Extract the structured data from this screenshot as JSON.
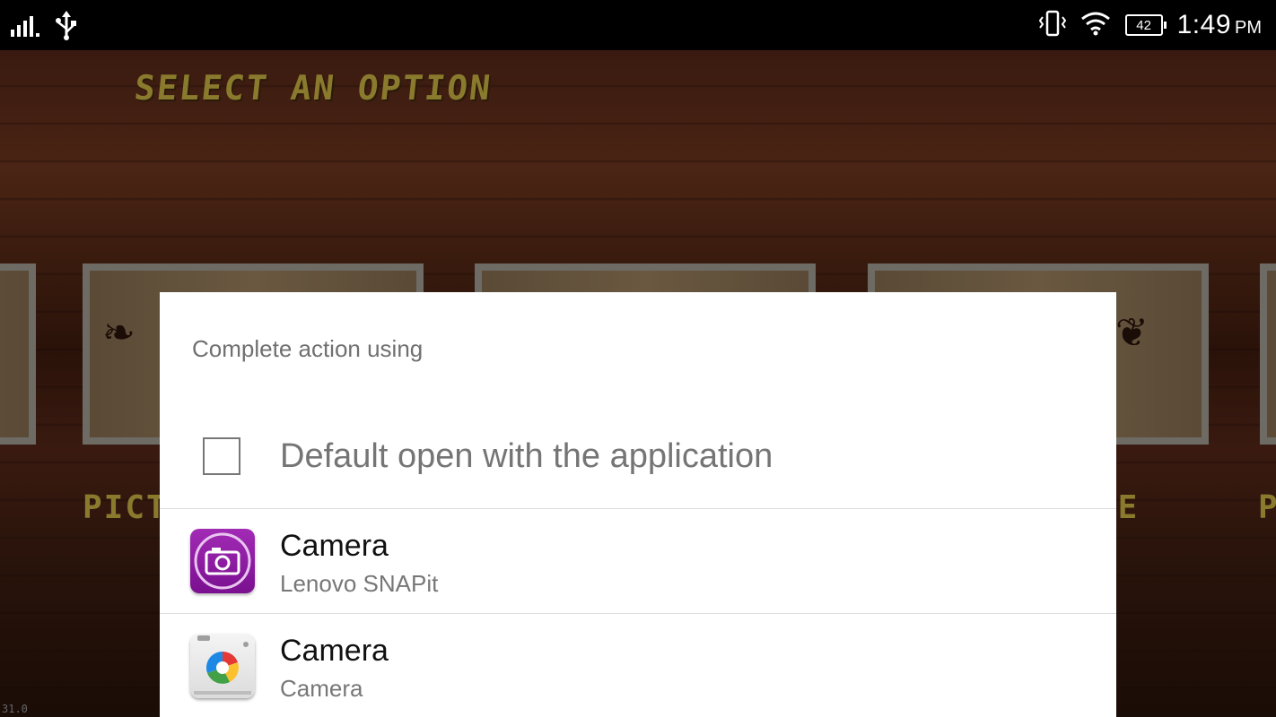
{
  "status_bar": {
    "time": "1:49",
    "ampm": "PM",
    "battery_level": "42",
    "icons": [
      "signal-icon",
      "usb-icon",
      "vibrate-icon",
      "wifi-icon",
      "battery-icon"
    ]
  },
  "background": {
    "title": "SELECT AN OPTION",
    "tile_labels": [
      "PICTU",
      "LE",
      "P"
    ],
    "debug_text": "31.0"
  },
  "dialog": {
    "title": "Complete action using",
    "default_label": "Default open with the application",
    "default_checked": false,
    "apps": [
      {
        "name": "Camera",
        "subtitle": "Lenovo SNAPit",
        "icon": "lenovo-snapit-camera-icon",
        "color": "#8e1fa3"
      },
      {
        "name": "Camera",
        "subtitle": "Camera",
        "icon": "google-camera-icon",
        "color": "#e8e8e8"
      }
    ]
  }
}
